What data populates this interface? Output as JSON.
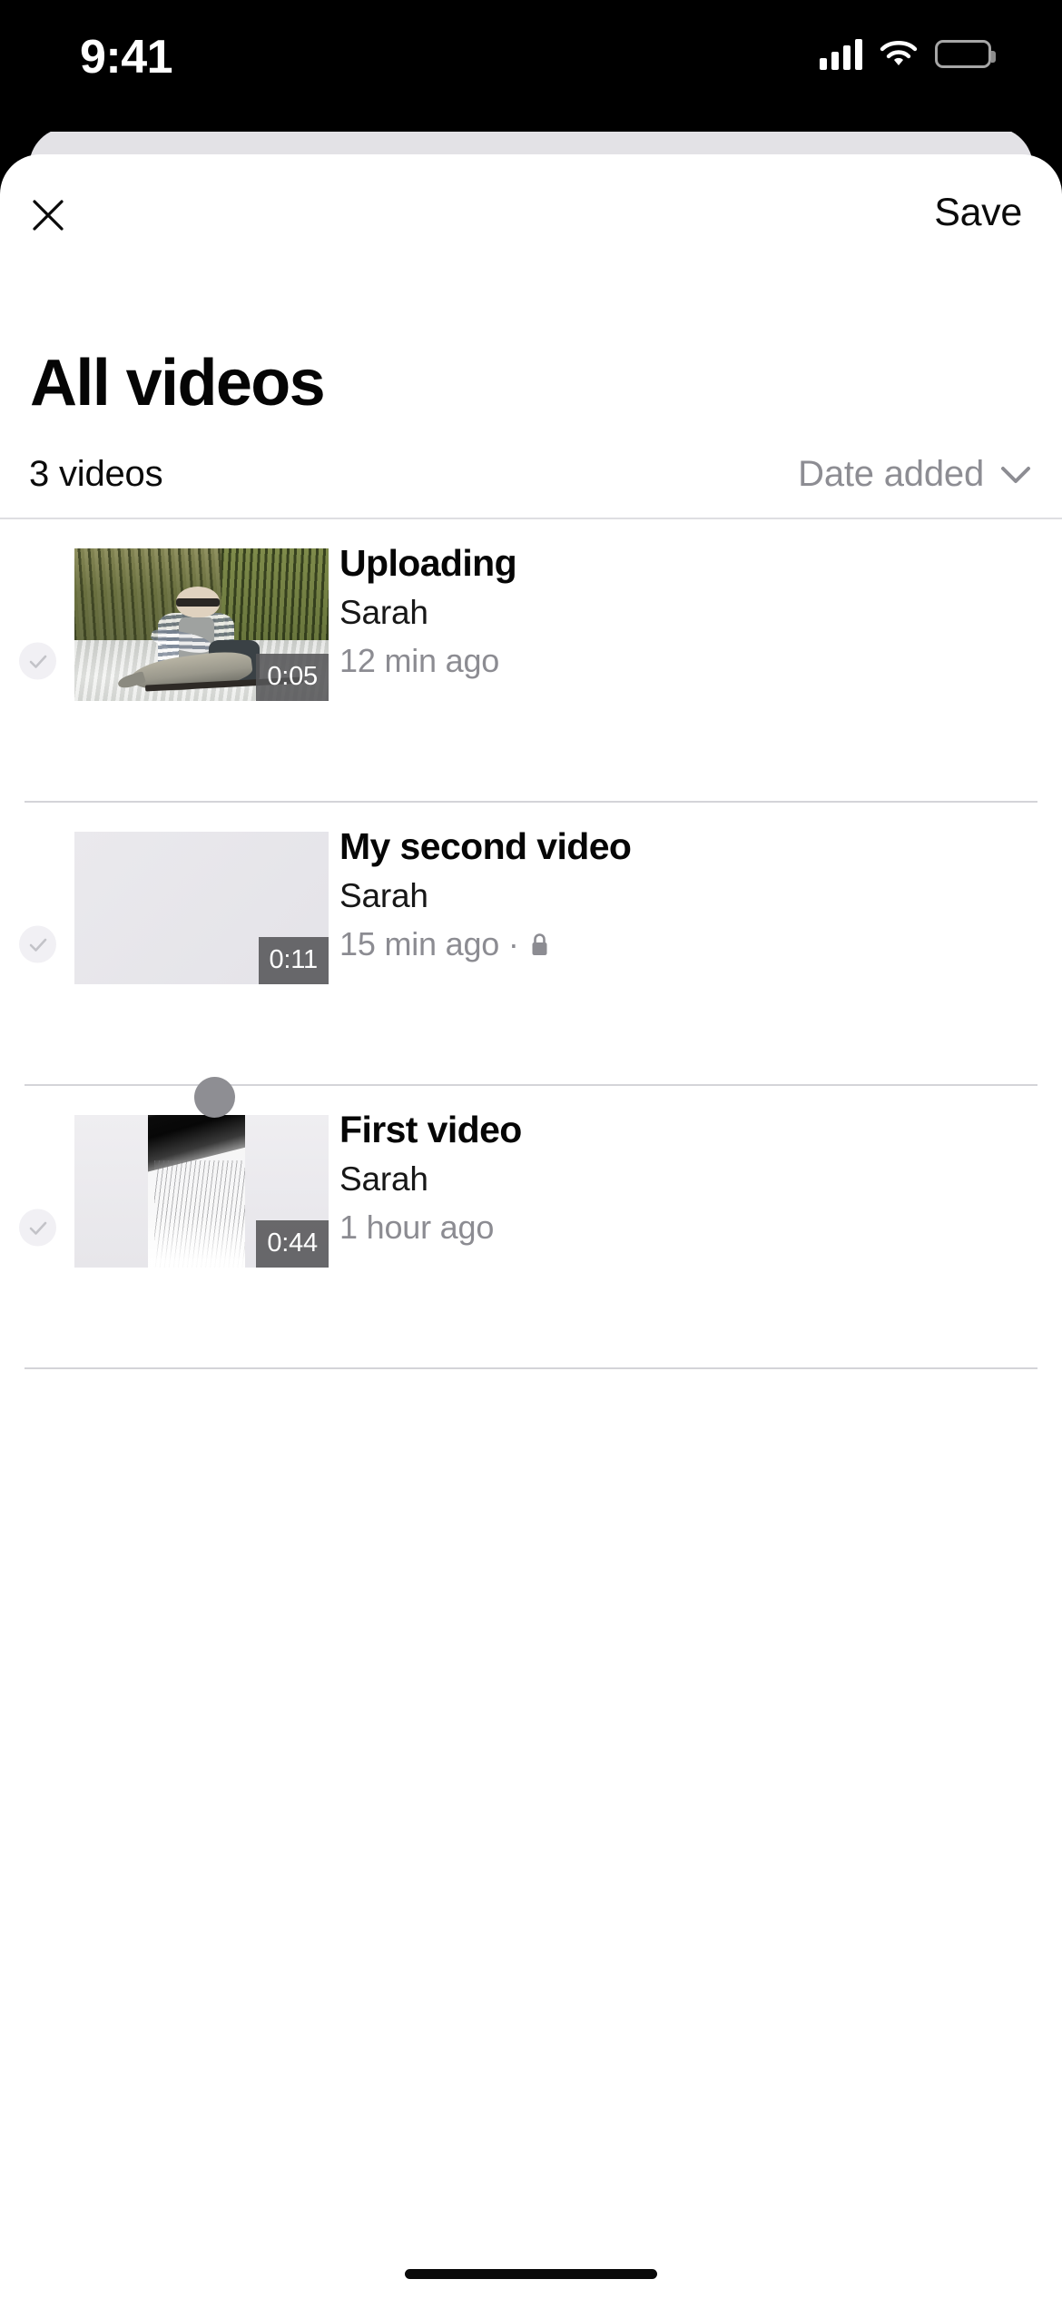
{
  "status_bar": {
    "time": "9:41",
    "signal_icon": "cellular-signal-icon",
    "wifi_icon": "wifi-icon",
    "battery_icon": "battery-icon"
  },
  "header": {
    "close_icon": "close-icon",
    "save_label": "Save"
  },
  "page": {
    "title": "All videos",
    "count_label": "3 videos",
    "sort_label": "Date added",
    "sort_chevron_icon": "chevron-down-icon"
  },
  "videos": [
    {
      "title": "Uploading",
      "author": "Sarah",
      "time": "12 min ago",
      "duration": "0:05",
      "thumb_kind": "photo",
      "thumb_alt": "man holding a fish in shallow water in front of tall reeds",
      "checked_icon": "check-icon",
      "private": false
    },
    {
      "title": "My second video",
      "author": "Sarah",
      "time": "15 min ago ·",
      "duration": "0:11",
      "thumb_kind": "blank",
      "thumb_alt": "blank gray placeholder thumbnail",
      "checked_icon": "check-icon",
      "private": true,
      "lock_icon": "lock-icon"
    },
    {
      "title": "First video",
      "author": "Sarah",
      "time": "1 hour ago",
      "duration": "0:44",
      "thumb_kind": "strip",
      "thumb_alt": "narrow dark waterfall strip between light gray bars",
      "checked_icon": "check-icon",
      "private": false
    }
  ],
  "loading_indicator": "loading-spinner-dot",
  "home_indicator": "home-indicator",
  "colors": {
    "accent": "#0B0B0B",
    "muted_text": "#8C8C92",
    "divider": "#D4D4D8",
    "check_bg": "#F1F0F4",
    "check_mark": "#C3C3C8",
    "badge_bg": "#555558"
  }
}
